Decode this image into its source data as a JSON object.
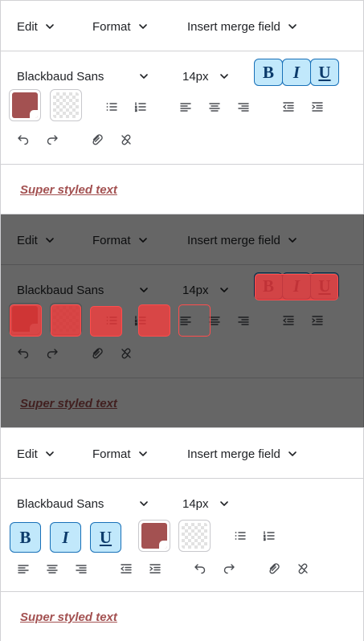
{
  "menus": {
    "edit": "Edit",
    "format": "Format",
    "insert_merge_field": "Insert merge field"
  },
  "toolbar": {
    "font_family": "Blackbaud Sans",
    "font_size": "14px",
    "bold": "B",
    "italic": "I",
    "underline": "U"
  },
  "content": {
    "text": "Super styled text"
  },
  "colors": {
    "text_color": "#a35151",
    "button_bg": "#c1e8fb",
    "button_border": "#1870b8",
    "overlay": "rgba(0,0,0,0.6)",
    "focus_marker": "#ff4d4d"
  },
  "icons": [
    "chevron-down-icon",
    "bulleted-list-icon",
    "numbered-list-icon",
    "align-left-icon",
    "align-center-icon",
    "align-right-icon",
    "outdent-icon",
    "indent-icon",
    "undo-icon",
    "redo-icon",
    "link-icon",
    "unlink-icon"
  ]
}
